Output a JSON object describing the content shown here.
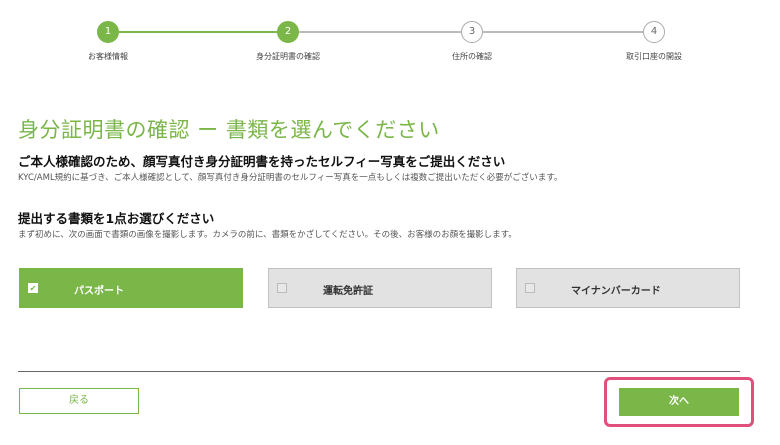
{
  "stepper": {
    "steps": [
      {
        "number": "1",
        "label": "お客様情報",
        "state": "done"
      },
      {
        "number": "2",
        "label": "身分証明書の確認",
        "state": "current"
      },
      {
        "number": "3",
        "label": "住所の確認",
        "state": "todo"
      },
      {
        "number": "4",
        "label": "取引口座の開設",
        "state": "todo"
      }
    ]
  },
  "main": {
    "title": "身分証明書の確認 ー 書類を選んでください",
    "heading": "ご本人様確認のため、顔写真付き身分証明書を持ったセルフィー写真をご提出ください",
    "description": "KYC/AML規約に基づき、ご本人様確認として、顔写真付き身分証明書のセルフィー写真を一点もしくは複数ご提出いただく必要がございます。",
    "select_heading": "提出する書類を1点お選びください",
    "select_description": "まず初めに、次の画面で書類の画像を撮影します。カメラの前に、書類をかざしてください。その後、お客様のお顔を撮影します。",
    "documents": [
      {
        "label": "パスポート",
        "selected": true,
        "check": "✔"
      },
      {
        "label": "運転免許証",
        "selected": false,
        "check": ""
      },
      {
        "label": "マイナンバーカード",
        "selected": false,
        "check": ""
      }
    ]
  },
  "footer": {
    "back_label": "戻る",
    "next_label": "次へ"
  },
  "colors": {
    "accent": "#7ab648",
    "highlight": "#e0507a",
    "option_unselected": "#e2e2e2"
  }
}
